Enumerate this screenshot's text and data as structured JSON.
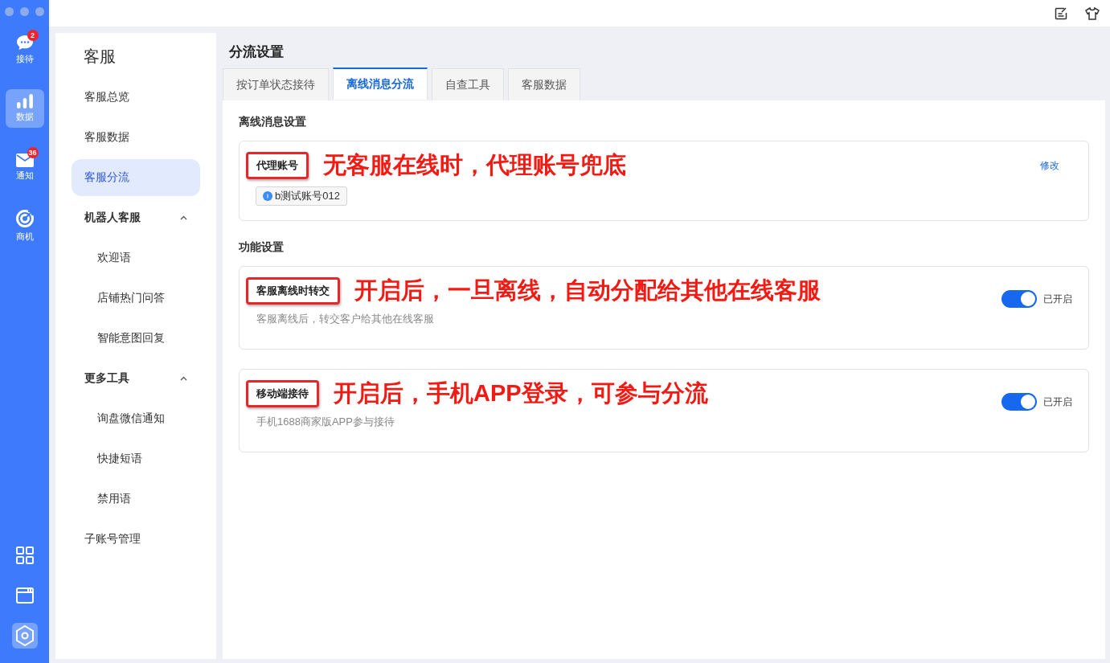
{
  "rail": {
    "items": [
      {
        "kind": "chat",
        "label": "接待",
        "badge": "2",
        "selected": false
      },
      {
        "kind": "chart",
        "label": "数据",
        "selected": true
      },
      {
        "kind": "mail",
        "label": "通知",
        "badge": "36",
        "selected": false
      },
      {
        "kind": "target",
        "label": "商机",
        "selected": false
      }
    ],
    "bottom_items": [
      {
        "kind": "grid",
        "selected": false
      },
      {
        "kind": "window",
        "selected": false
      },
      {
        "kind": "hexagon",
        "selected": true
      }
    ]
  },
  "nav": {
    "title": "客服",
    "items": [
      {
        "label": "客服总览",
        "selected": false
      },
      {
        "label": "客服数据",
        "selected": false
      },
      {
        "label": "客服分流",
        "selected": true
      },
      {
        "label": "机器人客服",
        "selected": false,
        "expanded": true,
        "children": [
          {
            "label": "欢迎语",
            "selected": false
          },
          {
            "label": "店铺热门问答",
            "selected": false
          },
          {
            "label": "智能意图回复",
            "selected": false
          }
        ]
      },
      {
        "label": "更多工具",
        "selected": false,
        "expanded": true,
        "children": [
          {
            "label": "询盘微信通知",
            "selected": false
          },
          {
            "label": "快捷短语",
            "selected": false
          },
          {
            "label": "禁用语",
            "selected": false
          }
        ]
      },
      {
        "label": "子账号管理",
        "selected": false
      }
    ]
  },
  "page_title": "分流设置",
  "tabs": [
    {
      "label": "按订单状态接待",
      "selected": false
    },
    {
      "label": "离线消息分流",
      "selected": true
    },
    {
      "label": "自查工具",
      "selected": false
    },
    {
      "label": "客服数据",
      "selected": false
    }
  ],
  "sections": [
    {
      "title": "离线消息设置",
      "cards": [
        {
          "kind": "account",
          "label": "代理账号",
          "highlighted": true,
          "annotation": "无客服在线时，代理账号兜底",
          "tag": "b测试账号012",
          "action": "修改"
        }
      ]
    },
    {
      "title": "功能设置",
      "cards": [
        {
          "kind": "switch",
          "label": "客服离线时转交",
          "highlighted": true,
          "annotation": "开启后，一旦离线，自动分配给其他在线客服",
          "description": "客服离线后，转交客户给其他在线客服",
          "on": true,
          "status": "已开启"
        },
        {
          "kind": "switch",
          "label": "移动端接待",
          "highlighted": true,
          "annotation": "开启后，手机APP登录，可参与分流",
          "description": "手机1688商家版APP参与接待",
          "on": true,
          "status": "已开启"
        }
      ]
    }
  ]
}
